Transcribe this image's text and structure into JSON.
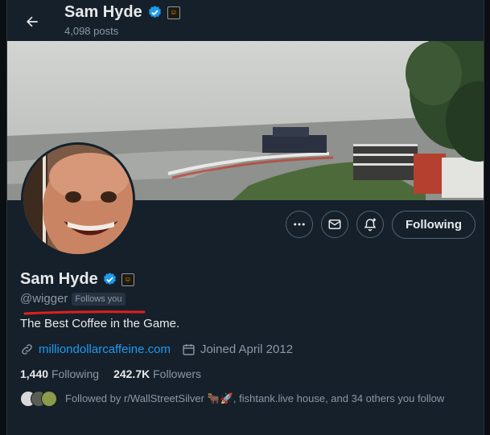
{
  "header": {
    "name": "Sam Hyde",
    "posts": "4,098 posts"
  },
  "profile": {
    "name": "Sam Hyde",
    "handle": "@wigger",
    "follows_you": "Follows you",
    "bio": "The Best Coffee in the Game.",
    "website": "milliondollarcaffeine.com",
    "joined": "Joined April 2012",
    "following_count": "1,440",
    "following_label": "Following",
    "followers_count": "242.7K",
    "followers_label": "Followers",
    "followed_by": "Followed by r/WallStreetSilver 🐂🚀, fishtank.live house, and 34 others you follow"
  },
  "actions": {
    "more_icon": "more-icon",
    "message_icon": "mail-icon",
    "notify_icon": "bell-plus-icon",
    "follow_label": "Following"
  },
  "colors": {
    "background": "#15202b",
    "verified": "#1d9bf0",
    "link": "#1d9bf0",
    "annotation_line": "#e0201b"
  }
}
